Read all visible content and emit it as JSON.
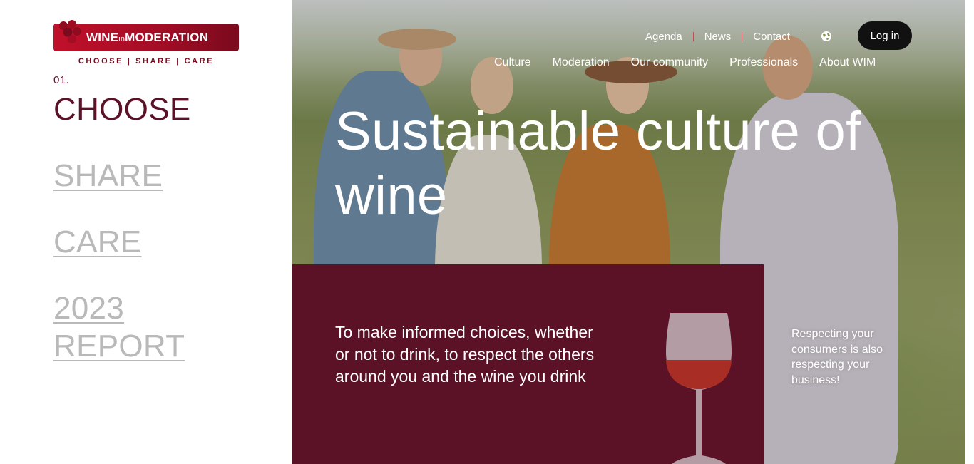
{
  "brand": {
    "logo_text_main": "WINE",
    "logo_text_small": "in",
    "logo_text_end": "MODERATION",
    "tagline": "CHOOSE | SHARE | CARE",
    "color_primary": "#5b1227",
    "color_logo": "#b30f27"
  },
  "steps": {
    "number": "01.",
    "active": "CHOOSE",
    "links": [
      "SHARE",
      "CARE",
      "2023 REPORT"
    ]
  },
  "utility_nav": {
    "items": [
      "Agenda",
      "News",
      "Contact"
    ],
    "globe_icon": "globe-icon",
    "login_label": "Log in"
  },
  "main_nav": {
    "items": [
      "Culture",
      "Moderation",
      "Our community",
      "Professionals",
      "About WIM"
    ]
  },
  "hero": {
    "title": "Sustainable culture of wine",
    "box_text": "To make informed choices, whether or not to drink, to respect the others around you and the wine you drink",
    "side_note": "Respecting your consumers is also respecting your business!",
    "glass_icon": "wine-glass-icon"
  }
}
